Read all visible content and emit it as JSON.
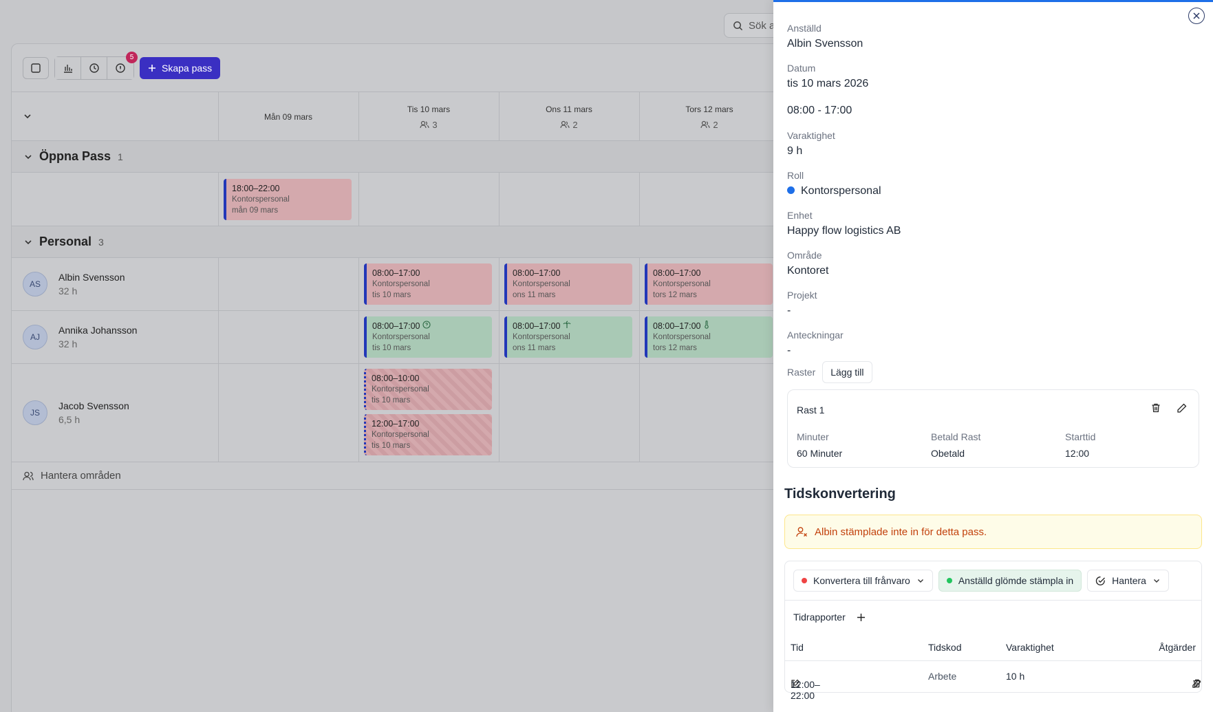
{
  "search": {
    "placeholder": "Sök a"
  },
  "toolbar": {
    "badge_count": "5",
    "create_label": "Skapa pass"
  },
  "days": [
    {
      "label": "Mån 09 mars",
      "count": ""
    },
    {
      "label": "Tis 10 mars",
      "count": "3"
    },
    {
      "label": "Ons 11 mars",
      "count": "2"
    },
    {
      "label": "Tors 12 mars",
      "count": "2"
    }
  ],
  "open_section": {
    "title": "Öppna Pass",
    "count": "1"
  },
  "open_shift": {
    "time": "18:00–22:00",
    "role": "Kontorspersonal",
    "date": "mån 09 mars"
  },
  "staff_section": {
    "title": "Personal",
    "count": "3"
  },
  "staff": [
    {
      "initials": "AS",
      "name": "Albin Svensson",
      "hours": "32 h",
      "shifts": [
        {
          "time": "08:00–17:00",
          "role": "Kontorspersonal",
          "date": "tis 10 mars"
        },
        {
          "time": "08:00–17:00",
          "role": "Kontorspersonal",
          "date": "ons 11 mars"
        },
        {
          "time": "08:00–17:00",
          "role": "Kontorspersonal",
          "date": "tors 12 mars"
        }
      ]
    },
    {
      "initials": "AJ",
      "name": "Annika Johansson",
      "hours": "32 h",
      "shifts": [
        {
          "time": "08:00–17:00",
          "role": "Kontorspersonal",
          "date": "tis 10 mars"
        },
        {
          "time": "08:00–17:00",
          "role": "Kontorspersonal",
          "date": "ons 11 mars"
        },
        {
          "time": "08:00–17:00",
          "role": "Kontorspersonal",
          "date": "tors 12 mars"
        }
      ]
    },
    {
      "initials": "JS",
      "name": "Jacob Svensson",
      "hours": "6,5 h",
      "shifts": [
        {
          "time": "08:00–10:00",
          "role": "Kontorspersonal",
          "date": "tis 10 mars"
        },
        {
          "time": "12:00–17:00",
          "role": "Kontorspersonal",
          "date": "tis 10 mars"
        }
      ]
    }
  ],
  "manage_areas": "Hantera områden",
  "panel": {
    "employee_label": "Anställd",
    "employee": "Albin Svensson",
    "date_label": "Datum",
    "date": "tis 10 mars 2026",
    "time_range": "08:00 - 17:00",
    "duration_label": "Varaktighet",
    "duration": "9 h",
    "role_label": "Roll",
    "role": "Kontorspersonal",
    "unit_label": "Enhet",
    "unit": "Happy flow logistics AB",
    "area_label": "Område",
    "area": "Kontoret",
    "project_label": "Projekt",
    "project": "-",
    "notes_label": "Anteckningar",
    "notes": "-",
    "breaks_label": "Raster",
    "add_label": "Lägg till",
    "break": {
      "title": "Rast 1",
      "minutes_label": "Minuter",
      "minutes": "60 Minuter",
      "paid_label": "Betald Rast",
      "paid": "Obetald",
      "start_label": "Starttid",
      "start": "12:00"
    },
    "conversion_title": "Tidskonvertering",
    "alert": "Albin stämplade inte in för detta pass.",
    "convert_absence": "Konvertera till frånvaro",
    "forgot_clock_in": "Anställd glömde stämpla in",
    "handle": "Hantera",
    "time_reports": "Tidrapporter",
    "table_headers": {
      "time": "Tid",
      "code": "Tidskod",
      "duration": "Varaktighet",
      "actions": "Åtgärder"
    },
    "report_row": {
      "time": "12:00–22:00",
      "code": "Arbete",
      "duration": "10 h"
    }
  },
  "colors": {
    "accent": "#1e6fe8",
    "primary_button": "#3a2fc2",
    "alert_text": "#c2410c",
    "absence_dot": "#ef4444",
    "active_dot": "#22c55e"
  }
}
